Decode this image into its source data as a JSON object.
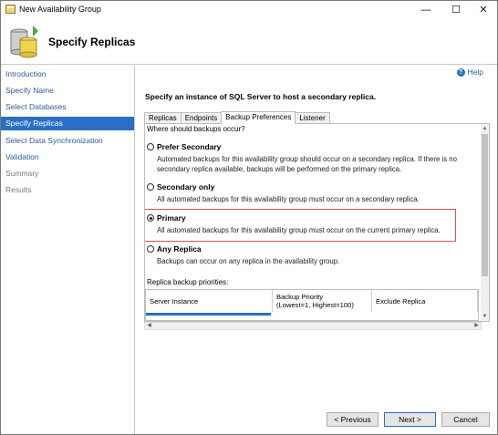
{
  "window": {
    "title": "New Availability Group",
    "controls": {
      "minimize": "—",
      "maximize": "☐",
      "close": "✕"
    }
  },
  "header": {
    "title": "Specify Replicas",
    "icon": "availability-group-wizard-icon"
  },
  "nav": {
    "items": [
      {
        "label": "Introduction",
        "state": "link"
      },
      {
        "label": "Specify Name",
        "state": "link"
      },
      {
        "label": "Select Databases",
        "state": "link"
      },
      {
        "label": "Specify Replicas",
        "state": "active"
      },
      {
        "label": "Select Data Synchronization",
        "state": "link"
      },
      {
        "label": "Validation",
        "state": "link"
      },
      {
        "label": "Summary",
        "state": "disabled"
      },
      {
        "label": "Results",
        "state": "disabled"
      }
    ]
  },
  "help": {
    "label": "Help",
    "icon": "help-icon"
  },
  "main": {
    "instruction": "Specify an instance of SQL Server to host a secondary replica.",
    "tabs": [
      {
        "label": "Replicas",
        "selected": false
      },
      {
        "label": "Endpoints",
        "selected": false
      },
      {
        "label": "Backup Preferences",
        "selected": true
      },
      {
        "label": "Listener",
        "selected": false
      }
    ],
    "question": "Where should backups occur?",
    "options": [
      {
        "label": "Prefer Secondary",
        "checked": false,
        "description": "Automated backups for this availability group should occur on a secondary replica. If there is no secondary replica available, backups will be performed on the primary replica."
      },
      {
        "label": "Secondary only",
        "checked": false,
        "description": "All automated backups for this availability group must occur on a secondary replica."
      },
      {
        "label": "Primary",
        "checked": true,
        "description": "All automated backups for this availability group must occur on the current primary replica."
      },
      {
        "label": "Any Replica",
        "checked": false,
        "description": "Backups can occur on any replica in the availability group."
      }
    ],
    "priorities_label": "Replica backup priorities:",
    "grid_columns": [
      "Server Instance",
      "Backup Priority\n(Lowest=1, Highest=100)",
      "Exclude Replica"
    ]
  },
  "footer": {
    "previous": "< Previous",
    "next": "Next >",
    "cancel": "Cancel"
  },
  "colors": {
    "accent": "#2a6fc7",
    "highlight_border": "#d9534f",
    "nav_link": "#2c5c9a"
  }
}
